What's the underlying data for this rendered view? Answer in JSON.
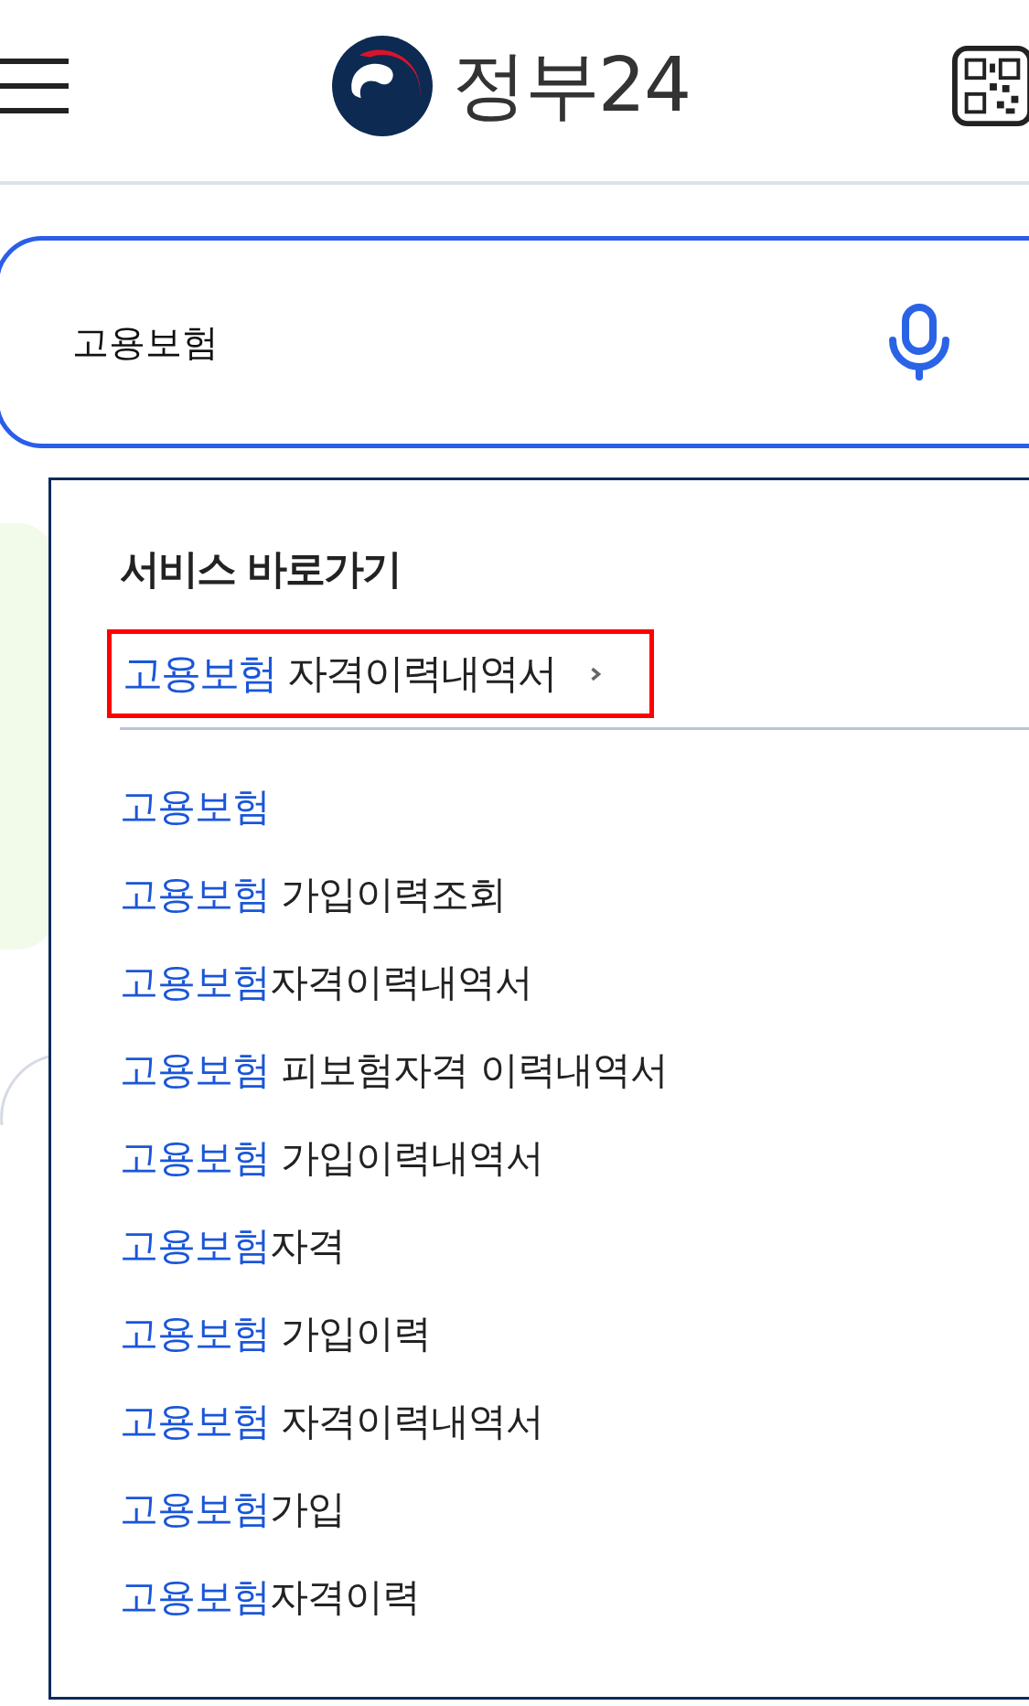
{
  "header": {
    "logo_text": "정부24"
  },
  "search": {
    "value": "고용보험"
  },
  "dropdown": {
    "title": "서비스 바로가기",
    "shortcut": {
      "match": "고용보험",
      "rest": " 자격이력내역서",
      "highlighted": true
    },
    "suggestions": [
      {
        "match": "고용보험"
      },
      {
        "match": "고용보험",
        "rest": " 가입이력조회"
      },
      {
        "match": "고용보험",
        "rest": "자격이력내역서"
      },
      {
        "match": "고용보험",
        "rest": " 피보험자격 이력내역서"
      },
      {
        "match": "고용보험",
        "rest": " 가입이력내역서"
      },
      {
        "match": "고용보험",
        "rest": "자격"
      },
      {
        "match": "고용보험",
        "rest": " 가입이력"
      },
      {
        "match": "고용보험",
        "rest": " 자격이력내역서"
      },
      {
        "match": "고용보험",
        "rest": "가입"
      },
      {
        "match": "고용보험",
        "rest": "자격이력"
      }
    ]
  }
}
